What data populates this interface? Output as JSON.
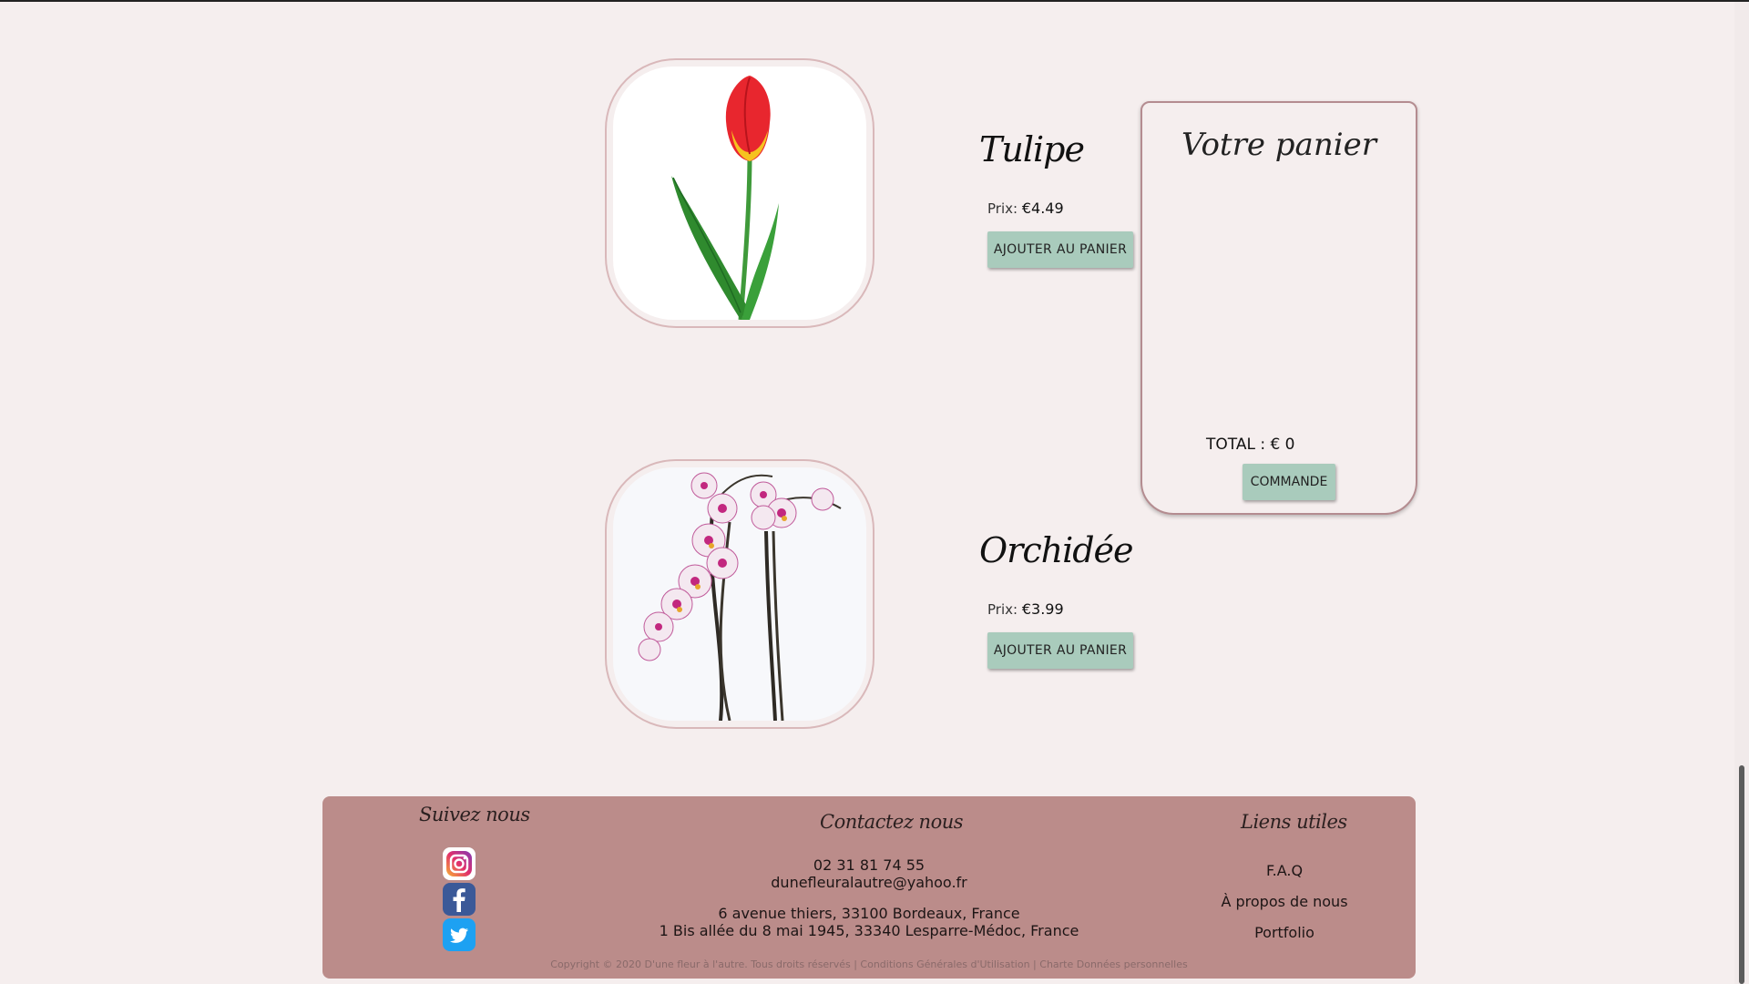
{
  "products": [
    {
      "name": "Tulipe",
      "price_label": "Prix:",
      "price_value": "€4.49",
      "add_button": "AJOUTER AU PANIER",
      "image_icon": "tulip-image"
    },
    {
      "name": "Orchidée",
      "price_label": "Prix:",
      "price_value": "€3.99",
      "add_button": "AJOUTER AU PANIER",
      "image_icon": "orchid-image"
    }
  ],
  "cart": {
    "title": "Votre panier",
    "total": "TOTAL : € 0",
    "order_button": "COMMANDE"
  },
  "footer": {
    "follow_heading": "Suivez nous",
    "contact_heading": "Contactez nous",
    "links_heading": "Liens utiles",
    "social": [
      "instagram-icon",
      "facebook-icon",
      "twitter-icon"
    ],
    "phone": "02 31 81 74 55",
    "email": "dunefleuralautre@yahoo.fr",
    "address_1": "6 avenue thiers, 33100 Bordeaux, France",
    "address_2": "1 Bis allée du 8 mai 1945, 33340 Lesparre-Médoc, France",
    "links": [
      "F.A.Q",
      "À propos de nous",
      "Portfolio"
    ],
    "copyright": "Copyright © 2020 D'une fleur à l'autre. Tous droits réservés | Conditions Générales d'Utilisation | Charte Données personnelles"
  },
  "colors": {
    "background": "#f5eeee",
    "button": "#a9cbbc",
    "footer": "#bb8c8a",
    "border": "#b48c90"
  }
}
